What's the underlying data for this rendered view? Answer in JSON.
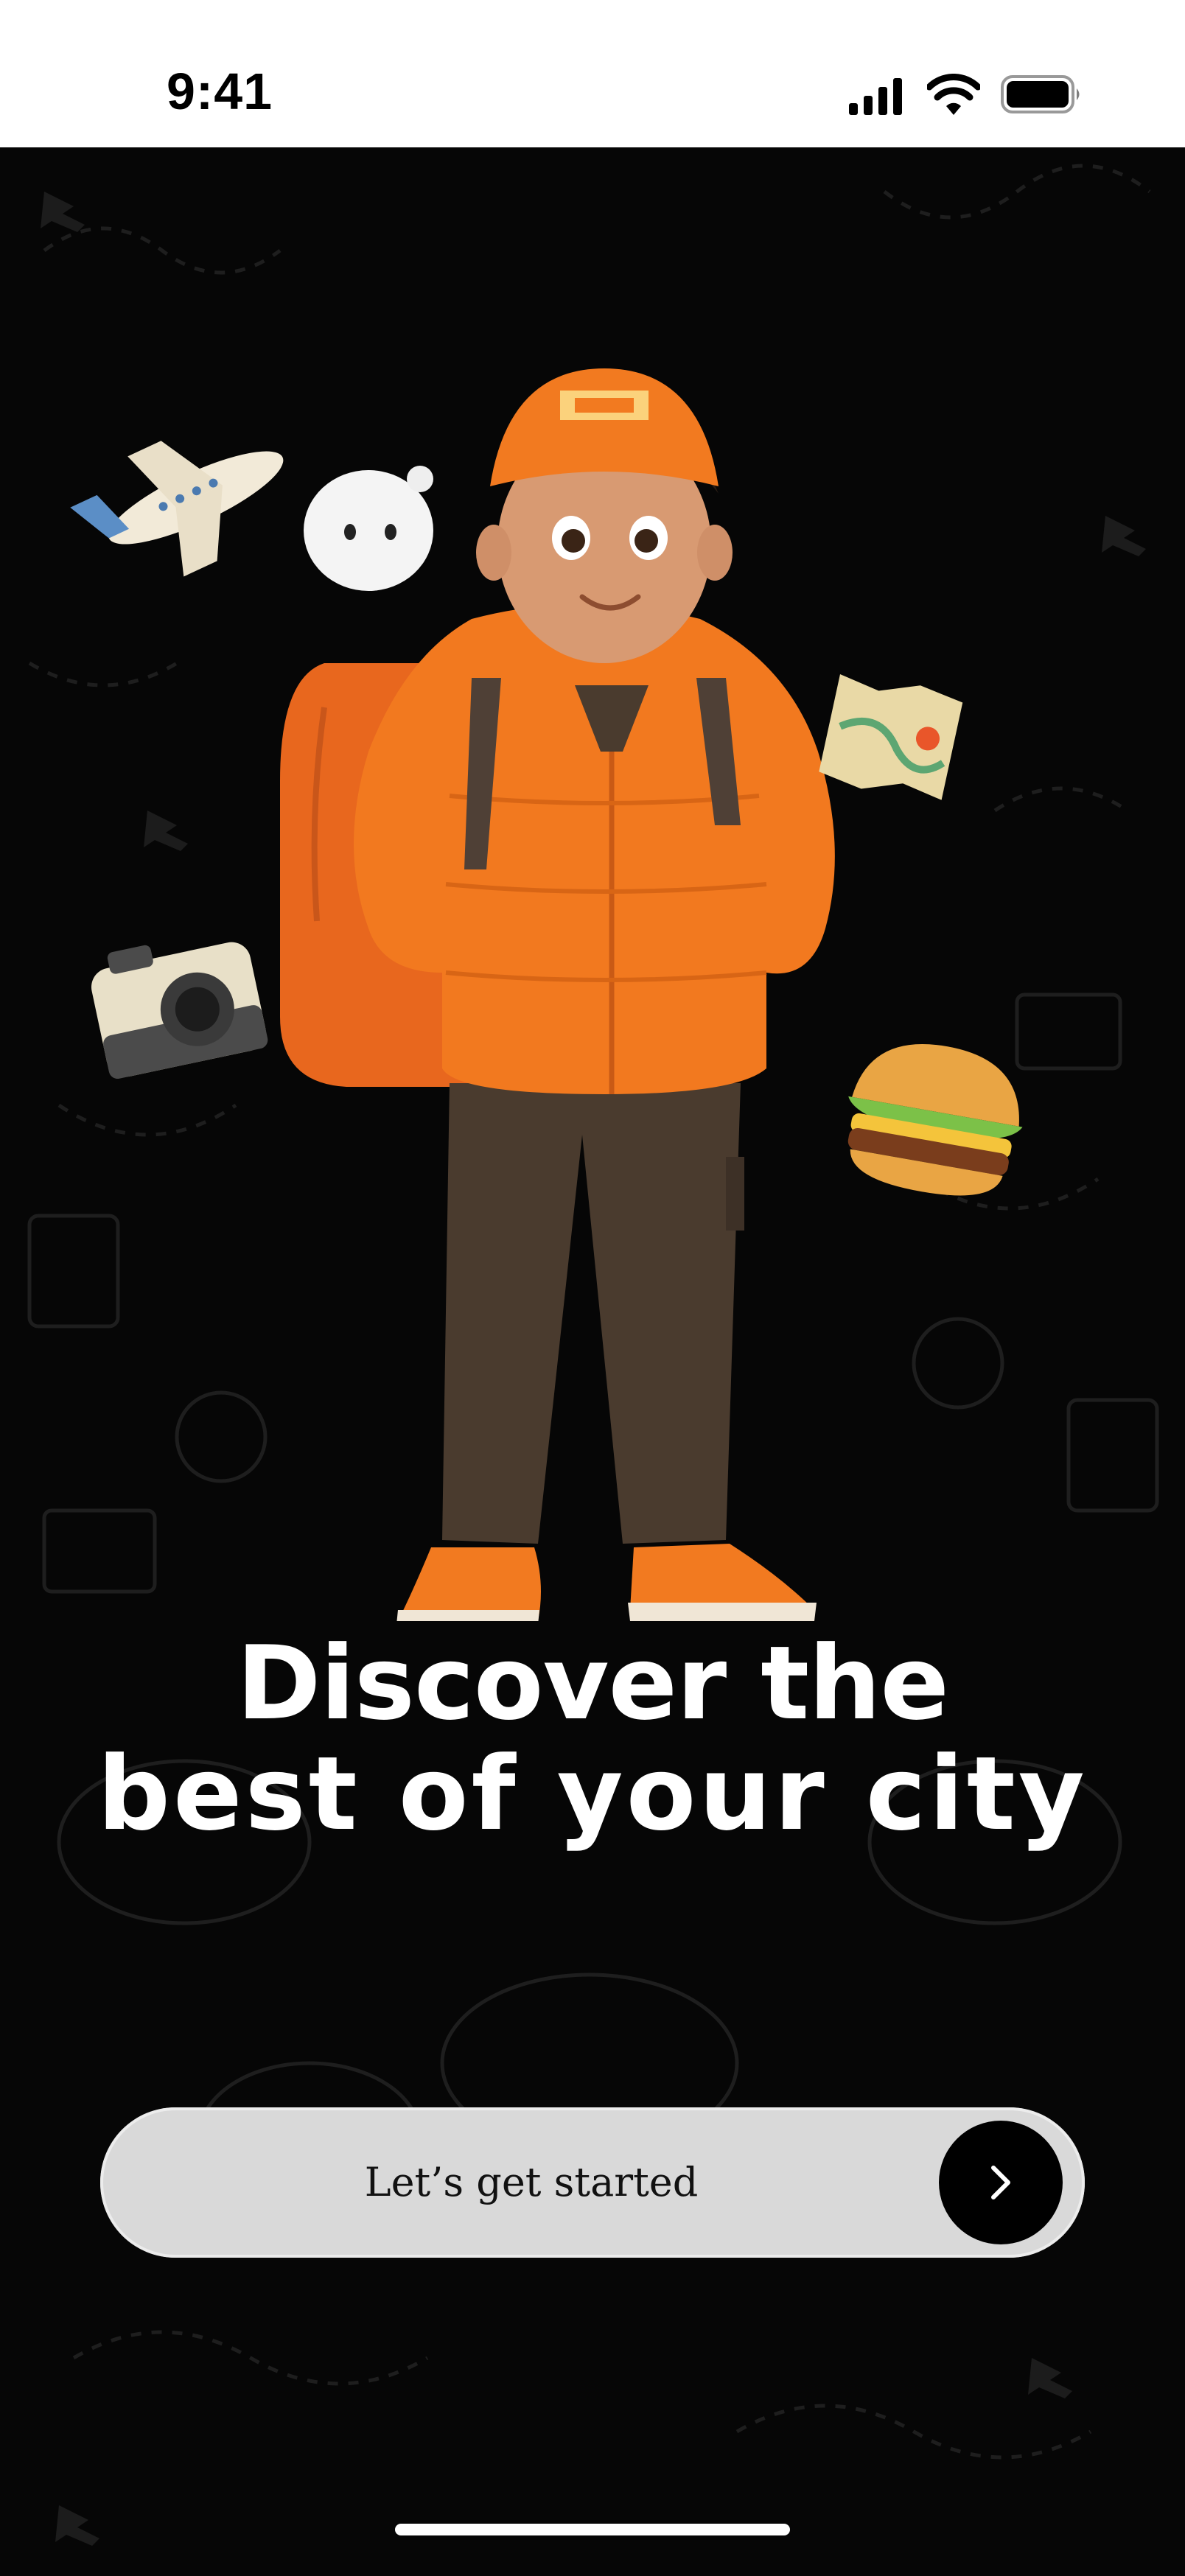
{
  "status_bar": {
    "time": "9:41",
    "icons": [
      "signal-icon",
      "wifi-icon",
      "battery-icon"
    ]
  },
  "hero": {
    "illustration": "traveler-boy-illustration",
    "floating_items": [
      "airplane-icon",
      "ghost-toy-icon",
      "map-icon",
      "camera-icon",
      "burger-icon"
    ]
  },
  "headline": {
    "line1": "Discover the",
    "line2": "best of your city"
  },
  "cta": {
    "label": "Let’s get started",
    "arrow_icon": "chevron-right-icon"
  },
  "colors": {
    "background": "#060606",
    "accent": "#F47B20",
    "button": "#D9D9D9",
    "text": "#FFFFFF"
  }
}
